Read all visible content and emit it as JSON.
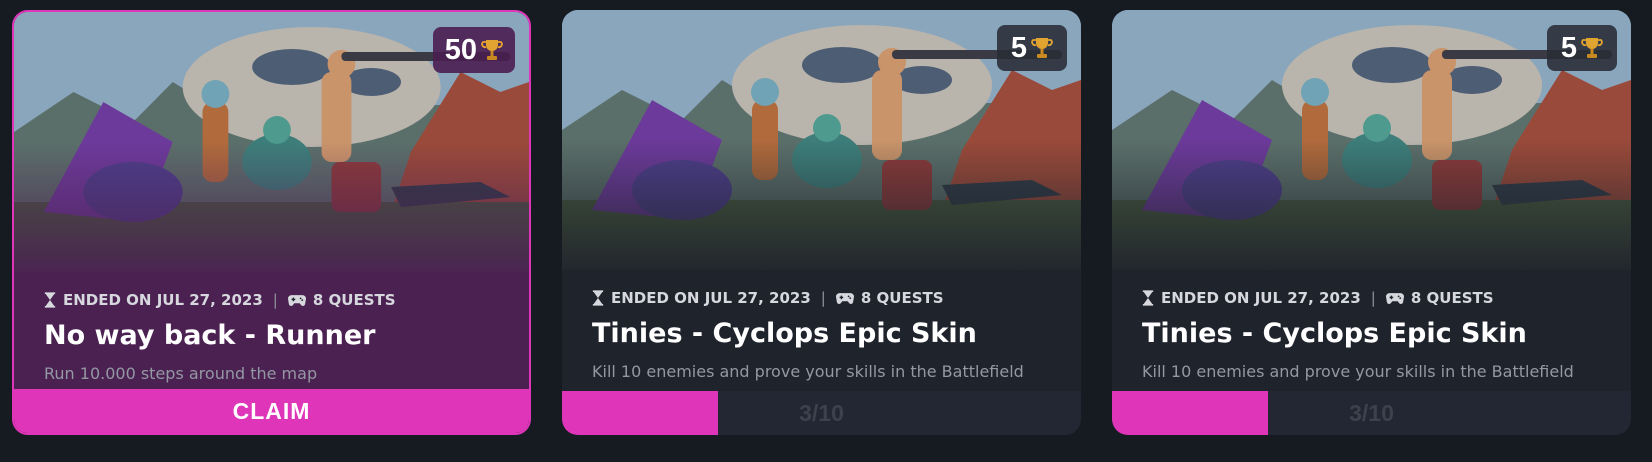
{
  "cards": [
    {
      "reward": "50",
      "ended": "ENDED ON JUL 27, 2023",
      "quests": "8 QUESTS",
      "title": "No way back - Runner",
      "description": "Run 10.000 steps around the map",
      "action": "CLAIM",
      "status": "completed",
      "reward_icon": "trophy-icon",
      "ended_icon": "hourglass-icon",
      "quests_icon": "gamepad-icon"
    },
    {
      "reward": "5",
      "ended": "ENDED ON JUL 27, 2023",
      "quests": "8 QUESTS",
      "title": "Tinies - Cyclops Epic Skin",
      "description": "Kill 10 enemies and prove your skills in the Battlefield",
      "progress_text": "3/10",
      "progress_value": 3,
      "progress_max": 10,
      "reward_icon": "trophy-icon",
      "ended_icon": "hourglass-icon",
      "quests_icon": "gamepad-icon"
    },
    {
      "reward": "5",
      "ended": "ENDED ON JUL 27, 2023",
      "quests": "8 QUESTS",
      "title": "Tinies - Cyclops Epic Skin",
      "description": "Kill 10 enemies and prove your skills in the Battlefield",
      "progress_text": "3/10",
      "progress_value": 3,
      "progress_max": 10,
      "reward_icon": "trophy-icon",
      "ended_icon": "hourglass-icon",
      "quests_icon": "gamepad-icon"
    }
  ],
  "colors": {
    "accent": "#df35b8",
    "card_bg": "#1f232c",
    "active_card_bg": "#4b2152",
    "page_bg": "#161a21"
  }
}
